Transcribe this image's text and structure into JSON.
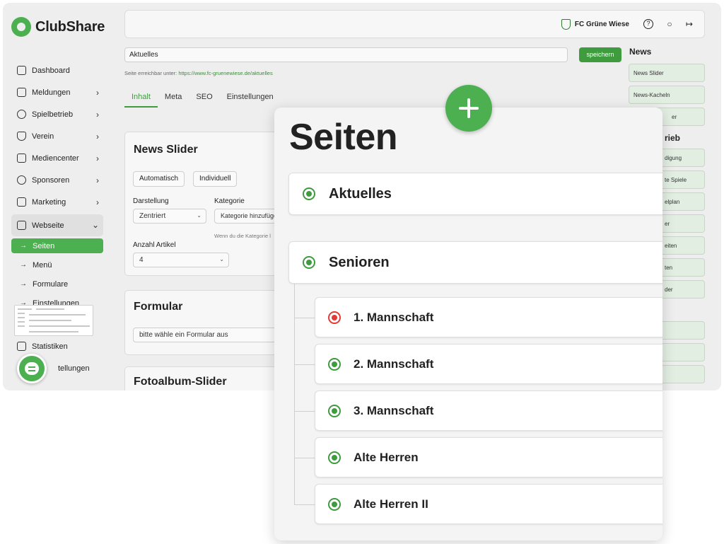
{
  "brand": {
    "name": "ClubShare"
  },
  "nav": {
    "items": [
      {
        "label": "Dashboard",
        "icon": "home-icon"
      },
      {
        "label": "Meldungen",
        "icon": "book-icon"
      },
      {
        "label": "Spielbetrieb",
        "icon": "soccer-ball-icon"
      },
      {
        "label": "Verein",
        "icon": "shield-icon"
      },
      {
        "label": "Mediencenter",
        "icon": "image-icon"
      },
      {
        "label": "Sponsoren",
        "icon": "target-icon"
      },
      {
        "label": "Marketing",
        "icon": "megaphone-icon"
      },
      {
        "label": "Webseite",
        "icon": "layers-icon"
      }
    ],
    "sub_items": [
      "Seiten",
      "Menü",
      "Formulare",
      "Einstellungen"
    ],
    "statistiken": "Statistiken",
    "einstellungen_partial": "tellungen"
  },
  "topbar": {
    "club_name": "FC Grüne Wiese"
  },
  "editor": {
    "title_value": "Aktuelles",
    "save_label": "speichern",
    "url_prefix": "Seite erreichbar unter:",
    "url": "https://www.fc-gruenewiese.de/aktuelles",
    "tabs": [
      "Inhalt",
      "Meta",
      "SEO",
      "Einstellungen"
    ]
  },
  "news_slider": {
    "title": "News Slider",
    "btn_auto": "Automatisch",
    "btn_individual": "Individuell",
    "label_darstellung": "Darstellung",
    "darstellung_value": "Zentriert",
    "label_kategorie": "Kategorie",
    "kategorie_placeholder": "Kategorie hinzufüge",
    "kategorie_hint": "Wenn du die Kategorie l",
    "label_anzahl": "Anzahl Artikel",
    "anzahl_value": "4"
  },
  "formular": {
    "title": "Formular",
    "select_value": "bitte wähle ein Formular aus"
  },
  "fotoalbum": {
    "title": "Fotoalbum-Slider"
  },
  "right_col": {
    "news_heading": "News",
    "news_items": [
      "News Slider",
      "News-Kacheln",
      "er"
    ],
    "spiel_heading_partial": "rieb",
    "spiel_items": [
      "digung",
      "te Spiele",
      "elplan",
      "er",
      "eiten",
      "ten",
      "der"
    ]
  },
  "overlay": {
    "title": "Seiten",
    "pages": [
      {
        "label": "Aktuelles",
        "status": "active"
      },
      {
        "label": "Senioren",
        "status": "active"
      }
    ],
    "children": [
      {
        "label": "1. Mannschaft",
        "status": "inactive"
      },
      {
        "label": "2. Mannschaft",
        "status": "active"
      },
      {
        "label": "3. Mannschaft",
        "status": "active"
      },
      {
        "label": "Alte Herren",
        "status": "active"
      },
      {
        "label": "Alte Herren II",
        "status": "active"
      }
    ]
  },
  "colors": {
    "accent": "#4caf50",
    "accent_dark": "#3e9b3e",
    "inactive_red": "#e53935"
  }
}
